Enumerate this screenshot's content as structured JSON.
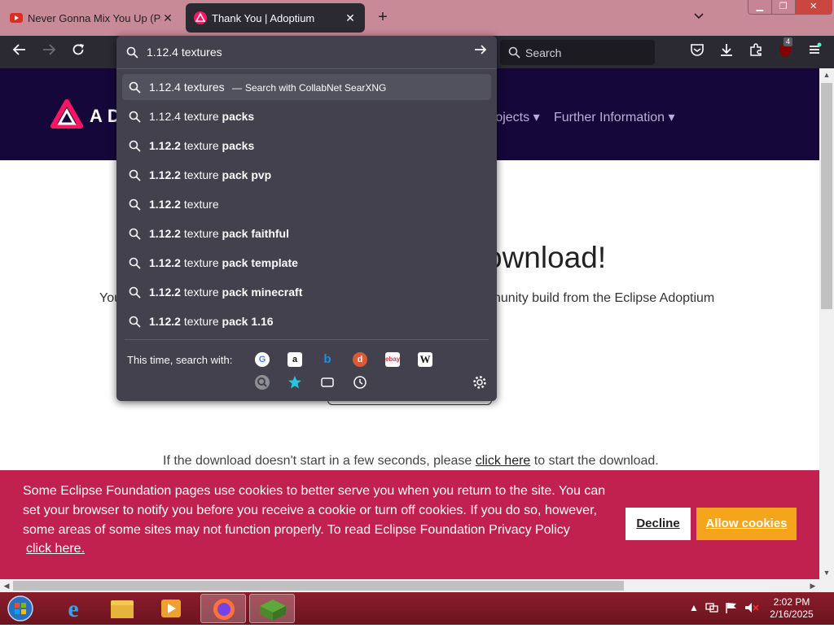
{
  "browser": {
    "tabs": [
      {
        "title": "Never Gonna Mix You Up (Part",
        "close": "✕"
      },
      {
        "title": "Thank You | Adoptium",
        "close": "✕"
      }
    ],
    "new_tab": "+",
    "search_placeholder": "Search",
    "extension_badge": "4"
  },
  "urlbar": {
    "value": "1.12.4 textures",
    "suggestions": [
      {
        "plain": "1.12.4 textures",
        "bold": "",
        "extra": "Search with CollabNet SearXNG"
      },
      {
        "plain": "1.12.4 texture ",
        "bold": "packs",
        "extra": ""
      },
      {
        "bold_lead": "1.12.2",
        "plain": " texture ",
        "bold": "packs",
        "extra": ""
      },
      {
        "bold_lead": "1.12.2",
        "plain": " texture ",
        "bold": "pack pvp",
        "extra": ""
      },
      {
        "bold_lead": "1.12.2",
        "plain": " texture",
        "bold": "",
        "extra": ""
      },
      {
        "bold_lead": "1.12.2",
        "plain": " texture ",
        "bold": "pack faithful",
        "extra": ""
      },
      {
        "bold_lead": "1.12.2",
        "plain": " texture ",
        "bold": "pack template",
        "extra": ""
      },
      {
        "bold_lead": "1.12.2",
        "plain": " texture ",
        "bold": "pack minecraft",
        "extra": ""
      },
      {
        "bold_lead": "1.12.2",
        "plain": " texture ",
        "bold": "pack 1.16",
        "extra": ""
      }
    ],
    "extra_dash": "—",
    "search_with_label": "This time, search with:"
  },
  "page": {
    "logo_text": "AD",
    "menu": [
      {
        "label": "rojects ▾"
      },
      {
        "label": "Further Information ▾"
      }
    ],
    "heading": "ownload!",
    "intro_left": "You",
    "intro_right": "nunity build from the Eclipse Adoptium",
    "note_before": "If the download doesn't start in a few seconds, please ",
    "note_link": "click here",
    "note_after": " to start the download."
  },
  "cookie": {
    "text": "Some Eclipse Foundation pages use cookies to better serve you when you return to the site. You can set your browser to notify you before you receive a cookie or turn off cookies. If you do so, however, some areas of some sites may not function properly. To read Eclipse Foundation Privacy Policy",
    "link": "click here.",
    "decline": "Decline",
    "allow": "Allow cookies"
  },
  "taskbar": {
    "time": "2:02 PM",
    "date": "2/16/2025"
  },
  "colors": {
    "accent": "#c0214f",
    "header_bg": "#16073b",
    "allow_btn": "#f4a51c",
    "toolbar": "#2b2a33",
    "panel": "#42414d"
  }
}
